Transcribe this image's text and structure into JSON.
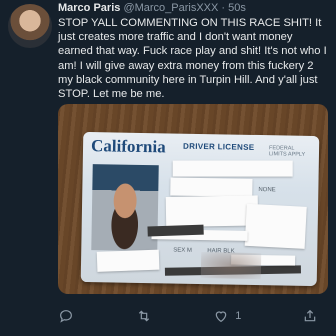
{
  "tweet": {
    "display_name": "Marco Paris",
    "handle": "@Marco_ParisXXX",
    "dot": "·",
    "time": "50s",
    "text": "STOP YALL COMMENTING ON THIS RACE SHIT! It just creates more traffic and I don't want money earned that way. Fuck race play and shit! It's not who I am! I will give away extra money from this fuckery 2 my black community here in Turpin Hill. And y'all just STOP. Let me be me.",
    "media": {
      "card_state": "California",
      "card_type": "DRIVER LICENSE",
      "federal_note": "FEDERAL LIMITS APPLY",
      "field_sex": "SEX M",
      "field_hair": "HAIR BLK",
      "field_none": "NONE"
    },
    "actions": {
      "reply_icon": "reply-icon",
      "retweet_icon": "retweet-icon",
      "like_icon": "heart-icon",
      "like_count": "1",
      "share_icon": "share-icon"
    }
  },
  "colors": {
    "background": "#15202b",
    "text": "#e7e9ea",
    "secondary": "#8b98a5"
  }
}
